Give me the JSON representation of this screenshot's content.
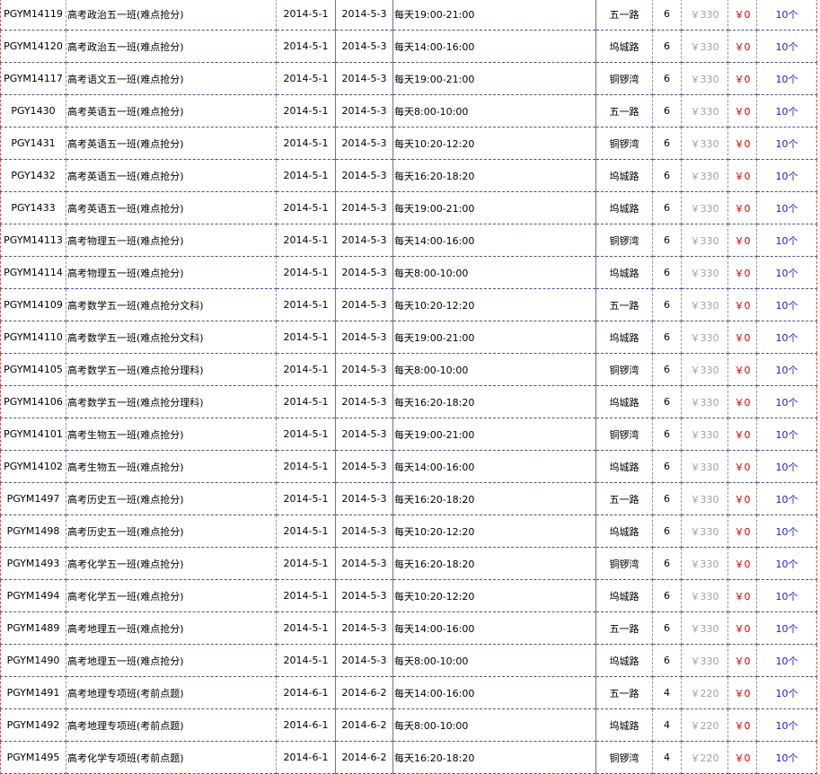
{
  "columns": [
    "code",
    "course",
    "start_date",
    "end_date",
    "time",
    "campus",
    "sessions",
    "original_price",
    "price",
    "quota"
  ],
  "rows": [
    [
      "PGYM14119",
      "高考政治五一班(难点抢分)",
      "2014-5-1",
      "2014-5-3",
      "每天19:00-21:00",
      "五一路",
      "6",
      "￥330",
      "￥0",
      "10个"
    ],
    [
      "PGYM14120",
      "高考政治五一班(难点抢分)",
      "2014-5-1",
      "2014-5-3",
      "每天14:00-16:00",
      "坞城路",
      "6",
      "￥330",
      "￥0",
      "10个"
    ],
    [
      "PGYM14117",
      "高考语文五一班(难点抢分)",
      "2014-5-1",
      "2014-5-3",
      "每天19:00-21:00",
      "铜锣湾",
      "6",
      "￥330",
      "￥0",
      "10个"
    ],
    [
      "PGY1430",
      "高考英语五一班(难点抢分)",
      "2014-5-1",
      "2014-5-3",
      "每天8:00-10:00",
      "五一路",
      "6",
      "￥330",
      "￥0",
      "10个"
    ],
    [
      "PGY1431",
      "高考英语五一班(难点抢分)",
      "2014-5-1",
      "2014-5-3",
      "每天10:20-12:20",
      "铜锣湾",
      "6",
      "￥330",
      "￥0",
      "10个"
    ],
    [
      "PGY1432",
      "高考英语五一班(难点抢分)",
      "2014-5-1",
      "2014-5-3",
      "每天16:20-18:20",
      "坞城路",
      "6",
      "￥330",
      "￥0",
      "10个"
    ],
    [
      "PGY1433",
      "高考英语五一班(难点抢分)",
      "2014-5-1",
      "2014-5-3",
      "每天19:00-21:00",
      "坞城路",
      "6",
      "￥330",
      "￥0",
      "10个"
    ],
    [
      "PGYM14113",
      "高考物理五一班(难点抢分)",
      "2014-5-1",
      "2014-5-3",
      "每天14:00-16:00",
      "铜锣湾",
      "6",
      "￥330",
      "￥0",
      "10个"
    ],
    [
      "PGYM14114",
      "高考物理五一班(难点抢分)",
      "2014-5-1",
      "2014-5-3",
      "每天8:00-10:00",
      "坞城路",
      "6",
      "￥330",
      "￥0",
      "10个"
    ],
    [
      "PGYM14109",
      "高考数学五一班(难点抢分文科)",
      "2014-5-1",
      "2014-5-3",
      "每天10:20-12:20",
      "五一路",
      "6",
      "￥330",
      "￥0",
      "10个"
    ],
    [
      "PGYM14110",
      "高考数学五一班(难点抢分文科)",
      "2014-5-1",
      "2014-5-3",
      "每天19:00-21:00",
      "坞城路",
      "6",
      "￥330",
      "￥0",
      "10个"
    ],
    [
      "PGYM14105",
      "高考数学五一班(难点抢分理科)",
      "2014-5-1",
      "2014-5-3",
      "每天8:00-10:00",
      "铜锣湾",
      "6",
      "￥330",
      "￥0",
      "10个"
    ],
    [
      "PGYM14106",
      "高考数学五一班(难点抢分理科)",
      "2014-5-1",
      "2014-5-3",
      "每天16:20-18:20",
      "坞城路",
      "6",
      "￥330",
      "￥0",
      "10个"
    ],
    [
      "PGYM14101",
      "高考生物五一班(难点抢分)",
      "2014-5-1",
      "2014-5-3",
      "每天19:00-21:00",
      "铜锣湾",
      "6",
      "￥330",
      "￥0",
      "10个"
    ],
    [
      "PGYM14102",
      "高考生物五一班(难点抢分)",
      "2014-5-1",
      "2014-5-3",
      "每天14:00-16:00",
      "坞城路",
      "6",
      "￥330",
      "￥0",
      "10个"
    ],
    [
      "PGYM1497",
      "高考历史五一班(难点抢分)",
      "2014-5-1",
      "2014-5-3",
      "每天16:20-18:20",
      "五一路",
      "6",
      "￥330",
      "￥0",
      "10个"
    ],
    [
      "PGYM1498",
      "高考历史五一班(难点抢分)",
      "2014-5-1",
      "2014-5-3",
      "每天10:20-12:20",
      "坞城路",
      "6",
      "￥330",
      "￥0",
      "10个"
    ],
    [
      "PGYM1493",
      "高考化学五一班(难点抢分)",
      "2014-5-1",
      "2014-5-3",
      "每天16:20-18:20",
      "铜锣湾",
      "6",
      "￥330",
      "￥0",
      "10个"
    ],
    [
      "PGYM1494",
      "高考化学五一班(难点抢分)",
      "2014-5-1",
      "2014-5-3",
      "每天10:20-12:20",
      "坞城路",
      "6",
      "￥330",
      "￥0",
      "10个"
    ],
    [
      "PGYM1489",
      "高考地理五一班(难点抢分)",
      "2014-5-1",
      "2014-5-3",
      "每天14:00-16:00",
      "五一路",
      "6",
      "￥330",
      "￥0",
      "10个"
    ],
    [
      "PGYM1490",
      "高考地理五一班(难点抢分)",
      "2014-5-1",
      "2014-5-3",
      "每天8:00-10:00",
      "坞城路",
      "6",
      "￥330",
      "￥0",
      "10个"
    ],
    [
      "PGYM1491",
      "高考地理专项班(考前点题)",
      "2014-6-1",
      "2014-6-2",
      "每天14:00-16:00",
      "五一路",
      "4",
      "￥220",
      "￥0",
      "10个"
    ],
    [
      "PGYM1492",
      "高考地理专项班(考前点题)",
      "2014-6-1",
      "2014-6-2",
      "每天8:00-10:00",
      "坞城路",
      "4",
      "￥220",
      "￥0",
      "10个"
    ],
    [
      "PGYM1495",
      "高考化学专项班(考前点题)",
      "2014-6-1",
      "2014-6-2",
      "每天16:20-18:20",
      "铜锣湾",
      "4",
      "￥220",
      "￥0",
      "10个"
    ]
  ]
}
